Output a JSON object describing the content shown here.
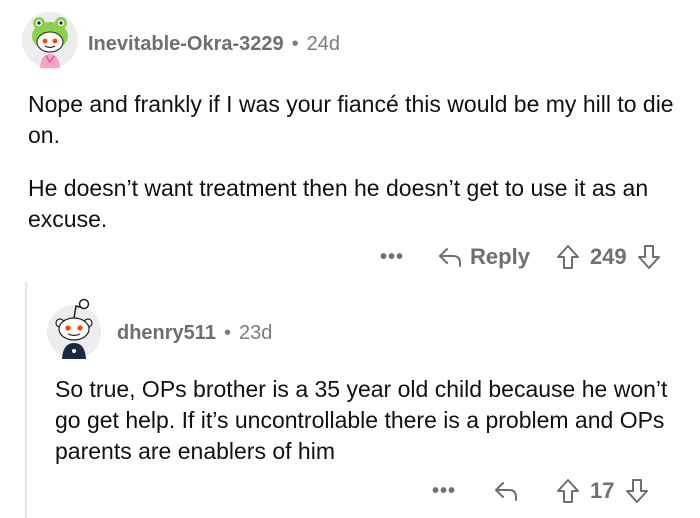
{
  "top_comment": {
    "username": "Inevitable-Okra-3229",
    "age": "24d",
    "paragraphs": [
      "Nope and frankly if I was your fiancé this would be my hill to die on.",
      "He doesn’t want treatment then he doesn’t get to use it as an excuse."
    ],
    "more_label": "•••",
    "reply_label": "Reply",
    "score": "249"
  },
  "reply_comment": {
    "username": "dhenry511",
    "age": "23d",
    "body": "So true, OPs brother is a 35 year old child because he won’t go get help. If it’s uncontrollable there is a problem and OPs parents are enablers of him",
    "more_label": "•••",
    "score": "17"
  },
  "separator": "•",
  "colors": {
    "text": "#111111",
    "meta": "#7c7c7c",
    "action": "#6f6f6f",
    "thread_line": "#e7e7e7",
    "avatar_green": "#8bd14a",
    "avatar_bg": "#ededed"
  },
  "icons": {
    "reply": "reply-arrow-icon",
    "upvote": "upvote-arrow-icon",
    "downvote": "downvote-arrow-icon",
    "more": "more-dots-icon"
  }
}
